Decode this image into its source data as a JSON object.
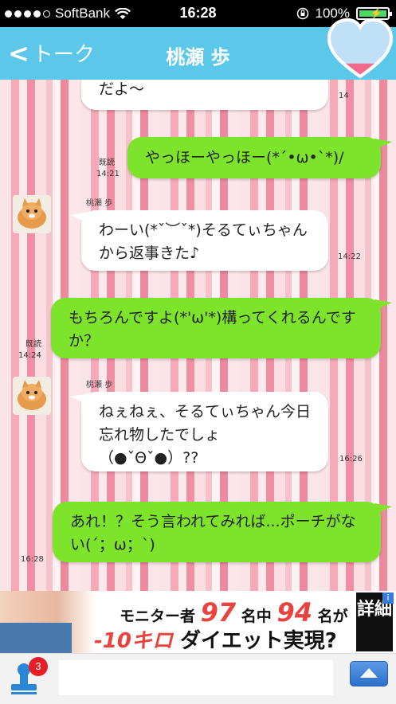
{
  "status_bar": {
    "carrier": "SoftBank",
    "time": "16:28",
    "battery": "100%",
    "signal_icon": "signal-dots-icon",
    "wifi_icon": "wifi-icon",
    "lock_icon": "rotation-lock-icon"
  },
  "nav": {
    "back_label": "トーク",
    "title": "桃瀬 歩",
    "heart_icon": "heart-gauge-icon",
    "heart_level": 0.25
  },
  "colors": {
    "nav_bg": "#5bc8ea",
    "out_bubble": "#7ee32b",
    "in_bubble": "#ffffff",
    "badge": "#e61e25"
  },
  "messages": [
    {
      "direction": "in",
      "text": "だよ〜",
      "time": "14"
    },
    {
      "direction": "out",
      "text": "やっほーやっほー(*´•ω•`*)/",
      "read": "既読",
      "time": "14:21"
    },
    {
      "direction": "in",
      "sender": "桃瀬 歩",
      "text": "わーい(*ˇ︶ˇ*)そるてぃちゃんから返事きた♪",
      "time": "14:22"
    },
    {
      "direction": "out",
      "text": "もちろんですよ(*'ω'*)構ってくれるんですか？",
      "read": "既読",
      "time": "14:24"
    },
    {
      "direction": "in",
      "sender": "桃瀬 歩",
      "text": "ねぇねぇ、そるてぃちゃん今日忘れ物したでしょ（●ˇΘˇ●）??",
      "time": "16:26"
    },
    {
      "direction": "out",
      "text": "あれ！？そう言われてみれば...ポーチがない(´；ω；`)",
      "time": "16:28"
    }
  ],
  "banner": {
    "text_prefix": "モニター者",
    "num1": "97",
    "text_mid": "名中",
    "num2": "94",
    "text_suffix": "名が",
    "highlight": "-10キロ",
    "tagline": "ダイエット実現?",
    "detail_label": "詳細",
    "info_label": "i"
  },
  "input": {
    "stamp_icon": "stamp-icon",
    "badge_count": "3",
    "placeholder": "",
    "send_icon": "send-arrow-icon"
  }
}
